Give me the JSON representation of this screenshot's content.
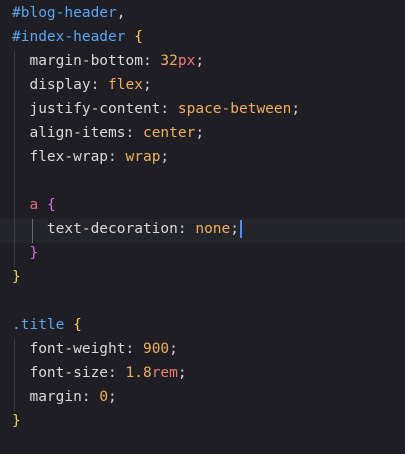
{
  "code": {
    "lines": [
      {
        "tokens": [
          {
            "t": "#blog-header",
            "c": "sel"
          },
          {
            "t": ",",
            "c": "punct"
          }
        ]
      },
      {
        "tokens": [
          {
            "t": "#index-header",
            "c": "sel"
          },
          {
            "t": " ",
            "c": "punct"
          },
          {
            "t": "{",
            "c": "brace-gold"
          }
        ]
      },
      {
        "tokens": [
          {
            "t": "  margin-bottom",
            "c": "prop"
          },
          {
            "t": ": ",
            "c": "punct"
          },
          {
            "t": "32",
            "c": "num"
          },
          {
            "t": "px",
            "c": "unit"
          },
          {
            "t": ";",
            "c": "punct"
          }
        ]
      },
      {
        "tokens": [
          {
            "t": "  display",
            "c": "prop"
          },
          {
            "t": ": ",
            "c": "punct"
          },
          {
            "t": "flex",
            "c": "val-kw"
          },
          {
            "t": ";",
            "c": "punct"
          }
        ]
      },
      {
        "tokens": [
          {
            "t": "  justify-content",
            "c": "prop"
          },
          {
            "t": ": ",
            "c": "punct"
          },
          {
            "t": "space-between",
            "c": "val-kw"
          },
          {
            "t": ";",
            "c": "punct"
          }
        ]
      },
      {
        "tokens": [
          {
            "t": "  align-items",
            "c": "prop"
          },
          {
            "t": ": ",
            "c": "punct"
          },
          {
            "t": "center",
            "c": "val-kw"
          },
          {
            "t": ";",
            "c": "punct"
          }
        ]
      },
      {
        "tokens": [
          {
            "t": "  flex-wrap",
            "c": "prop"
          },
          {
            "t": ": ",
            "c": "punct"
          },
          {
            "t": "wrap",
            "c": "val-kw"
          },
          {
            "t": ";",
            "c": "punct"
          }
        ]
      },
      {
        "tokens": []
      },
      {
        "tokens": [
          {
            "t": "  a",
            "c": "tag"
          },
          {
            "t": " ",
            "c": "punct"
          },
          {
            "t": "{",
            "c": "brace-purple"
          }
        ]
      },
      {
        "tokens": [
          {
            "t": "    text-decoration",
            "c": "prop"
          },
          {
            "t": ": ",
            "c": "punct"
          },
          {
            "t": "none",
            "c": "val-kw"
          },
          {
            "t": ";",
            "c": "punct"
          }
        ],
        "cursor": true
      },
      {
        "tokens": [
          {
            "t": "  }",
            "c": "brace-purple"
          }
        ]
      },
      {
        "tokens": [
          {
            "t": "}",
            "c": "brace-gold"
          }
        ]
      },
      {
        "tokens": []
      },
      {
        "tokens": [
          {
            "t": ".title",
            "c": "sel"
          },
          {
            "t": " ",
            "c": "punct"
          },
          {
            "t": "{",
            "c": "brace-gold"
          }
        ]
      },
      {
        "tokens": [
          {
            "t": "  font-weight",
            "c": "prop"
          },
          {
            "t": ": ",
            "c": "punct"
          },
          {
            "t": "900",
            "c": "num"
          },
          {
            "t": ";",
            "c": "punct"
          }
        ]
      },
      {
        "tokens": [
          {
            "t": "  font-size",
            "c": "prop"
          },
          {
            "t": ": ",
            "c": "punct"
          },
          {
            "t": "1.8",
            "c": "num"
          },
          {
            "t": "rem",
            "c": "unit"
          },
          {
            "t": ";",
            "c": "punct"
          }
        ]
      },
      {
        "tokens": [
          {
            "t": "  margin",
            "c": "prop"
          },
          {
            "t": ": ",
            "c": "punct"
          },
          {
            "t": "0",
            "c": "num"
          },
          {
            "t": ";",
            "c": "punct"
          }
        ]
      },
      {
        "tokens": [
          {
            "t": "}",
            "c": "brace-gold"
          }
        ]
      }
    ]
  },
  "colors": {
    "background": "#1e1e24",
    "selector": "#59a7f0",
    "keyword_value": "#f0b05a",
    "unit": "#f07a7a",
    "brace_outer": "#f7d154",
    "brace_nested": "#c775e0",
    "cursor": "#4f8cff"
  }
}
